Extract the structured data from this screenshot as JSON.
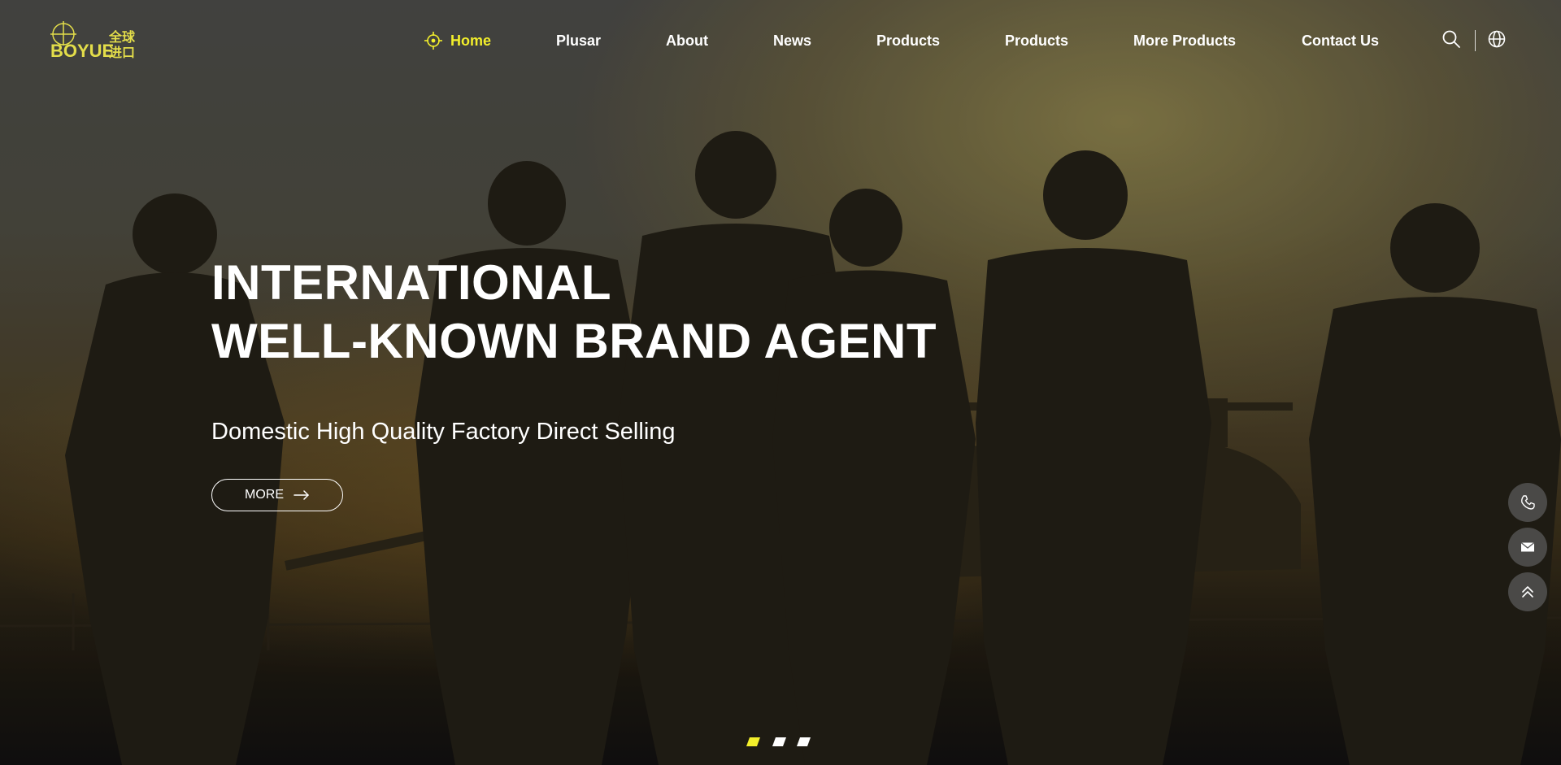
{
  "brand": {
    "logo_text": "BOYUE",
    "logo_cn": "全球进口",
    "accent_color": "#f3ef2b"
  },
  "nav": {
    "items": [
      {
        "label": "Home",
        "active": true
      },
      {
        "label": "Plusar"
      },
      {
        "label": "About"
      },
      {
        "label": "News"
      },
      {
        "label": "Products"
      },
      {
        "label": "Products"
      },
      {
        "label": "More Products"
      },
      {
        "label": "Contact Us"
      }
    ],
    "icons": [
      "crosshair-icon",
      "search-icon",
      "globe-icon"
    ]
  },
  "hero": {
    "headline_line1": "INTERNATIONAL",
    "headline_line2": "WELL-KNOWN BRAND AGENT",
    "subtitle": "Domestic High Quality Factory Direct Selling",
    "button_label": "MORE"
  },
  "side_buttons": [
    "phone-icon",
    "mail-icon",
    "back-to-top-icon"
  ],
  "carousel": {
    "slide_count": 3,
    "active_index": 0
  }
}
